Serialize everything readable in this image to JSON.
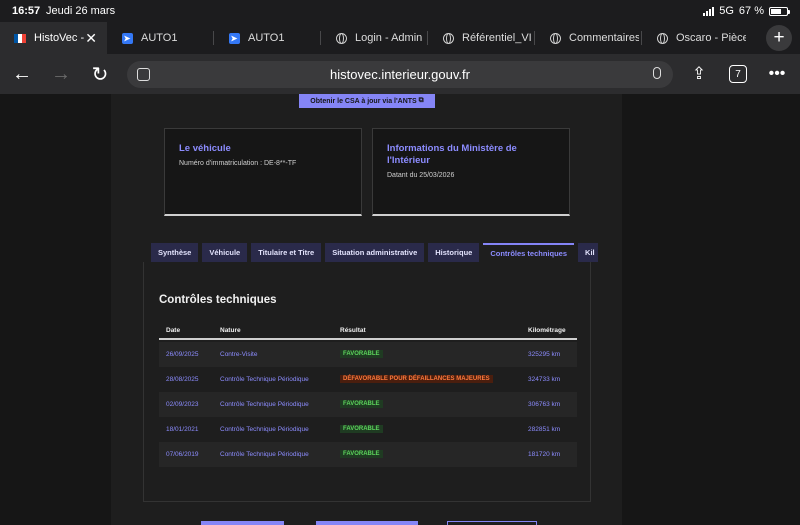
{
  "status": {
    "time": "16:57",
    "date": "Jeudi 26 mars",
    "network": "5G",
    "battery": "67 %",
    "battery_level": 0.67
  },
  "browser_tabs": [
    {
      "title": "HistoVec -",
      "icon": "france-flag-icon",
      "active": true
    },
    {
      "title": "AUTO1",
      "icon": "auto1-icon",
      "active": false
    },
    {
      "title": "AUTO1",
      "icon": "auto1-icon",
      "active": false
    },
    {
      "title": "Login - Admin",
      "icon": "globe-icon",
      "active": false
    },
    {
      "title": "Référentiel_VIN",
      "icon": "globe-icon",
      "active": false
    },
    {
      "title": "Commentaires",
      "icon": "globe-icon",
      "active": false
    },
    {
      "title": "Oscaro - Pièce",
      "icon": "globe-icon",
      "active": false
    }
  ],
  "toolbar": {
    "url": "histovec.interieur.gouv.fr",
    "tab_count": "7"
  },
  "page": {
    "ants_button": "Obtenir le CSA à jour via l'ANTS",
    "vehicle_card": {
      "title": "Le véhicule",
      "plate": "Numéro d'immatriculation : DE-8**-TF"
    },
    "ministry_card": {
      "title": "Informations du Ministère de l'Intérieur",
      "date": "Datant du 25/03/2026"
    },
    "tabs": [
      "Synthèse",
      "Véhicule",
      "Titulaire et Titre",
      "Situation administrative",
      "Historique",
      "Contrôles techniques",
      "Kil"
    ],
    "active_tab": "Contrôles techniques",
    "section_title": "Contrôles techniques",
    "table": {
      "headers": [
        "Date",
        "Nature",
        "Résultat",
        "Kilométrage"
      ],
      "rows": [
        {
          "date": "26/09/2025",
          "nature": "Contre-Visite",
          "result": "FAVORABLE",
          "status": "ok",
          "km": "325295 km"
        },
        {
          "date": "28/08/2025",
          "nature": "Contrôle Technique Périodique",
          "result": "DÉFAVORABLE POUR DÉFAILLANCES MAJEURES",
          "status": "ko",
          "km": "324733 km"
        },
        {
          "date": "02/09/2023",
          "nature": "Contrôle Technique Périodique",
          "result": "FAVORABLE",
          "status": "ok",
          "km": "306763 km"
        },
        {
          "date": "18/01/2021",
          "nature": "Contrôle Technique Périodique",
          "result": "FAVORABLE",
          "status": "ok",
          "km": "282851 km"
        },
        {
          "date": "07/06/2019",
          "nature": "Contrôle Technique Périodique",
          "result": "FAVORABLE",
          "status": "ok",
          "km": "181720 km"
        }
      ]
    }
  },
  "colors": {
    "accent": "#8585f6",
    "ok": "#5cd45c",
    "ko": "#ff7a3d"
  }
}
